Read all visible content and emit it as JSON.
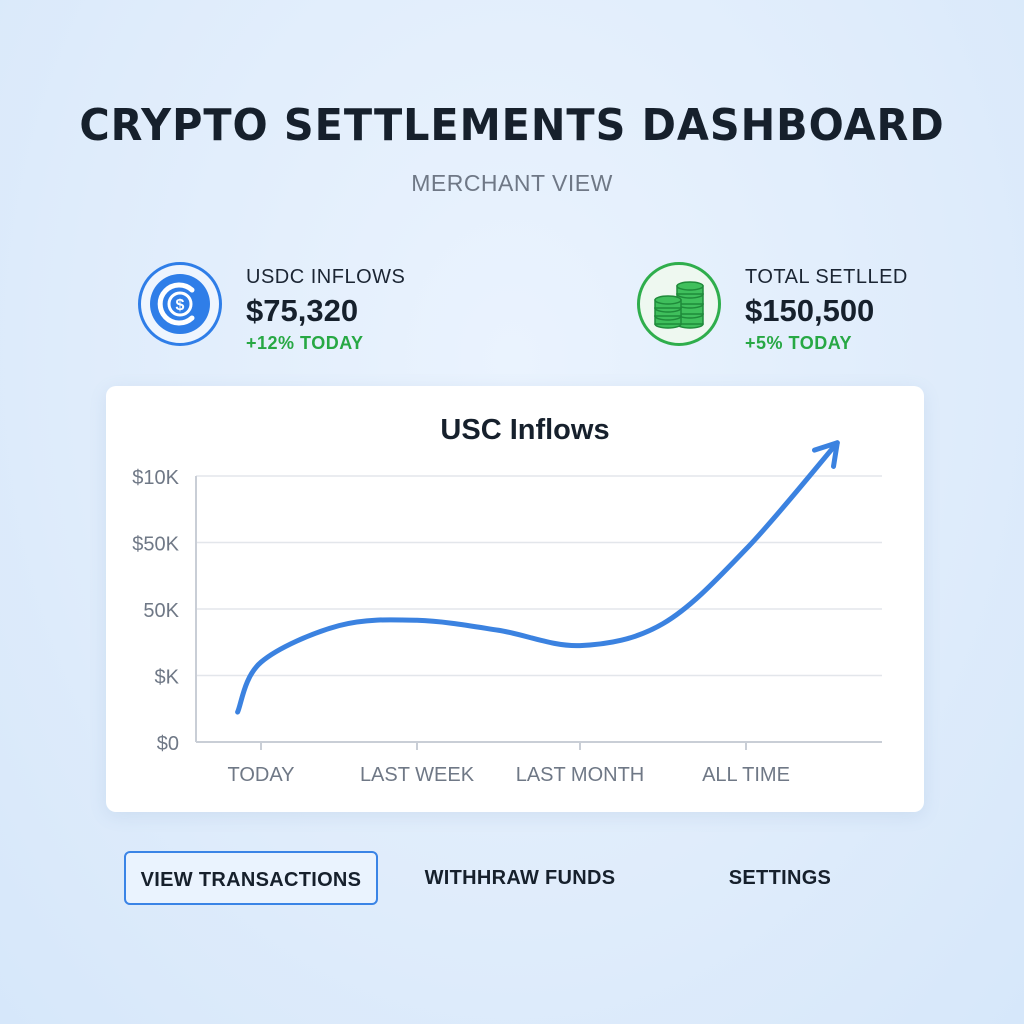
{
  "header": {
    "title": "CRYPTO SETTLEMENTS DASHBOARD",
    "subtitle": "MERCHANT VIEW"
  },
  "stats": [
    {
      "label": "USDC INFLOWS",
      "value": "$75,320",
      "change": "+12% TODAY",
      "icon": "usdc-coin-icon",
      "color": "#2f7ee8"
    },
    {
      "label": "TOTAL SETLLED",
      "value": "$150,500",
      "change": "+5% TODAY",
      "icon": "coin-stack-icon",
      "color": "#2fae4c"
    }
  ],
  "chart_data": {
    "type": "line",
    "title": "USC Inflows",
    "categories": [
      "TODAY",
      "LAST WEEK",
      "LAST MONTH",
      "ALL TIME"
    ],
    "y_tick_labels": [
      "$0",
      "$K",
      "50K",
      "$50K",
      "$10K"
    ],
    "series": [
      {
        "color": "#3b82e0",
        "points": [
          {
            "x": -0.15,
            "y": 0.45
          },
          {
            "x": 0.0,
            "y": 1.2
          },
          {
            "x": 0.5,
            "y": 1.75
          },
          {
            "x": 1.0,
            "y": 1.83
          },
          {
            "x": 1.5,
            "y": 1.68
          },
          {
            "x": 2.0,
            "y": 1.45
          },
          {
            "x": 2.5,
            "y": 1.78
          },
          {
            "x": 3.0,
            "y": 2.9
          },
          {
            "x": 3.55,
            "y": 4.5
          }
        ],
        "end_marker": "arrow"
      }
    ],
    "grid": true,
    "legend": "none"
  },
  "actions": {
    "view_transactions": "VIEW TRANSACTIONS",
    "withdraw_funds": "WITHHRAW FUNDS",
    "settings": "SETTINGS"
  }
}
